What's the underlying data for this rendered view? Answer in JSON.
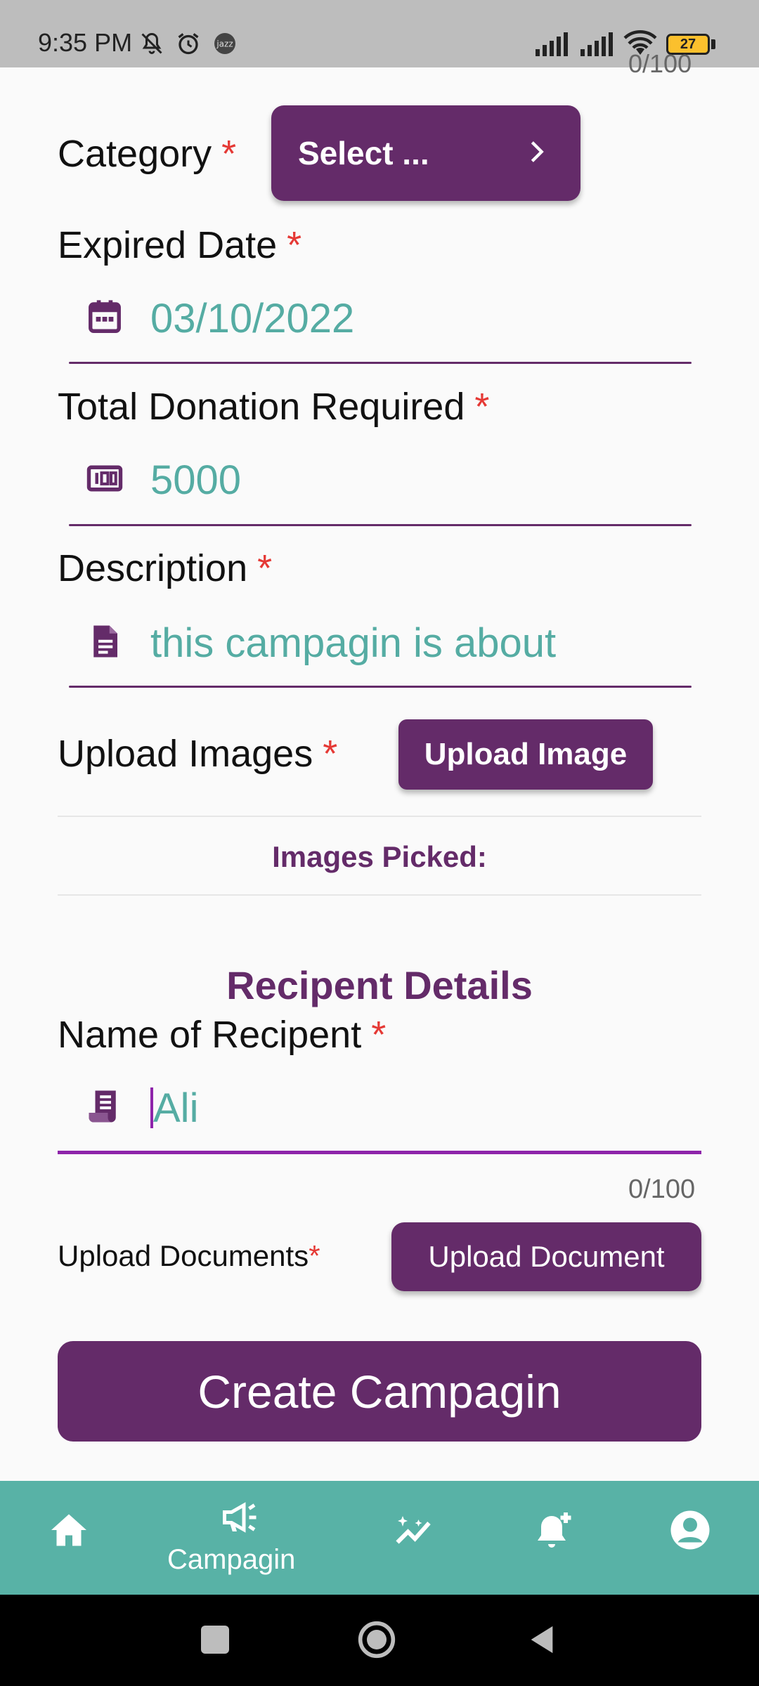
{
  "status_bar": {
    "time": "9:35 PM",
    "battery": "27",
    "icons": [
      "mute-icon",
      "alarm-icon",
      "jazz-app-icon",
      "signal-icon",
      "signal-icon",
      "wifi-icon",
      "battery-icon"
    ]
  },
  "form": {
    "top_counter": "0/100",
    "required_mark": "*",
    "category": {
      "label": "Category",
      "select_label": "Select ...",
      "icon": "chevron-right-icon"
    },
    "expired_date": {
      "label": "Expired Date",
      "value": "03/10/2022",
      "icon": "calendar-icon"
    },
    "total_donation": {
      "label": "Total Donation Required",
      "value": "5000",
      "icon": "money-icon"
    },
    "description": {
      "label": "Description",
      "value": "this campagin is about",
      "icon": "document-icon"
    },
    "upload_images": {
      "label": "Upload Images",
      "button": "Upload Image",
      "picked_label": "Images Picked:"
    },
    "recipient": {
      "section_title": "Recipent Details",
      "name_label": "Name of Recipent",
      "name_value": "Ali",
      "icon": "receipt-icon",
      "counter": "0/100"
    },
    "upload_documents": {
      "label": "Upload Documents",
      "button": "Upload Document"
    },
    "submit": "Create Campagin"
  },
  "bottom_nav": {
    "items": [
      {
        "icon": "home-icon"
      },
      {
        "icon": "campaign-icon",
        "label": "Campagin"
      },
      {
        "icon": "insights-icon"
      },
      {
        "icon": "notification-add-icon"
      },
      {
        "icon": "account-icon"
      }
    ]
  },
  "colors": {
    "primary": "#642b69",
    "teal": "#58b2a6",
    "value_text": "#55aca3",
    "required": "#e53935",
    "active_underline": "#8e24aa"
  }
}
